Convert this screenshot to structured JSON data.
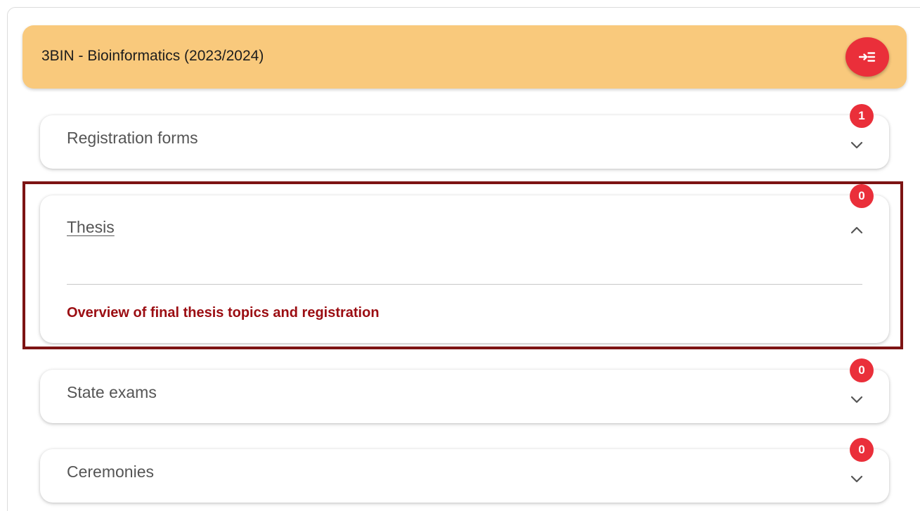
{
  "header": {
    "title": "3BIN - Bioinformatics (2023/2024)",
    "collapse_icon": "arrow-right-to-list-icon"
  },
  "sections": [
    {
      "title": "Registration forms",
      "badge": "1",
      "expanded": false
    },
    {
      "title": "Thesis",
      "badge": "0",
      "expanded": true,
      "link": "Overview of final thesis topics and registration"
    },
    {
      "title": "State exams",
      "badge": "0",
      "expanded": false
    },
    {
      "title": "Ceremonies",
      "badge": "0",
      "expanded": false
    }
  ],
  "colors": {
    "header_bg": "#f9c97c",
    "accent_red": "#ea2f3a",
    "link_red": "#9b0d12",
    "highlight_border": "#7d1414"
  }
}
